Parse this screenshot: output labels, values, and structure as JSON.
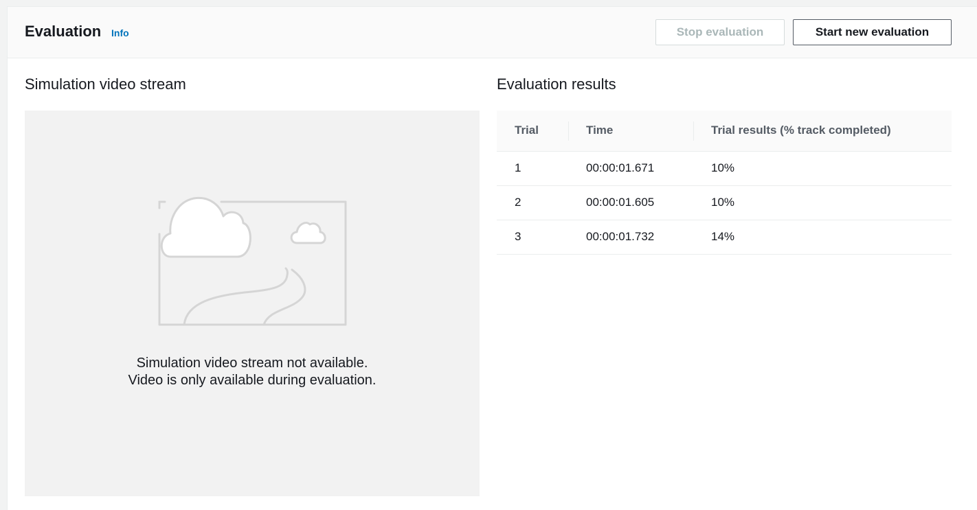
{
  "header": {
    "title": "Evaluation",
    "info_label": "Info",
    "stop_button_label": "Stop evaluation",
    "start_button_label": "Start new evaluation"
  },
  "video": {
    "title": "Simulation video stream",
    "message_line1": "Simulation video stream not available.",
    "message_line2": "Video is only available during evaluation.",
    "illustration_icon": "landscape-placeholder-icon"
  },
  "results": {
    "title": "Evaluation results",
    "columns": [
      "Trial",
      "Time",
      "Trial results (% track completed)"
    ],
    "rows": [
      {
        "trial": "1",
        "time": "00:00:01.671",
        "result": "10%"
      },
      {
        "trial": "2",
        "time": "00:00:01.605",
        "result": "10%"
      },
      {
        "trial": "3",
        "time": "00:00:01.732",
        "result": "14%"
      }
    ]
  },
  "colors": {
    "link": "#0073bb",
    "disabled_text": "#aab7b8",
    "text": "#16191f",
    "placeholder_bg": "#f2f2f2"
  }
}
